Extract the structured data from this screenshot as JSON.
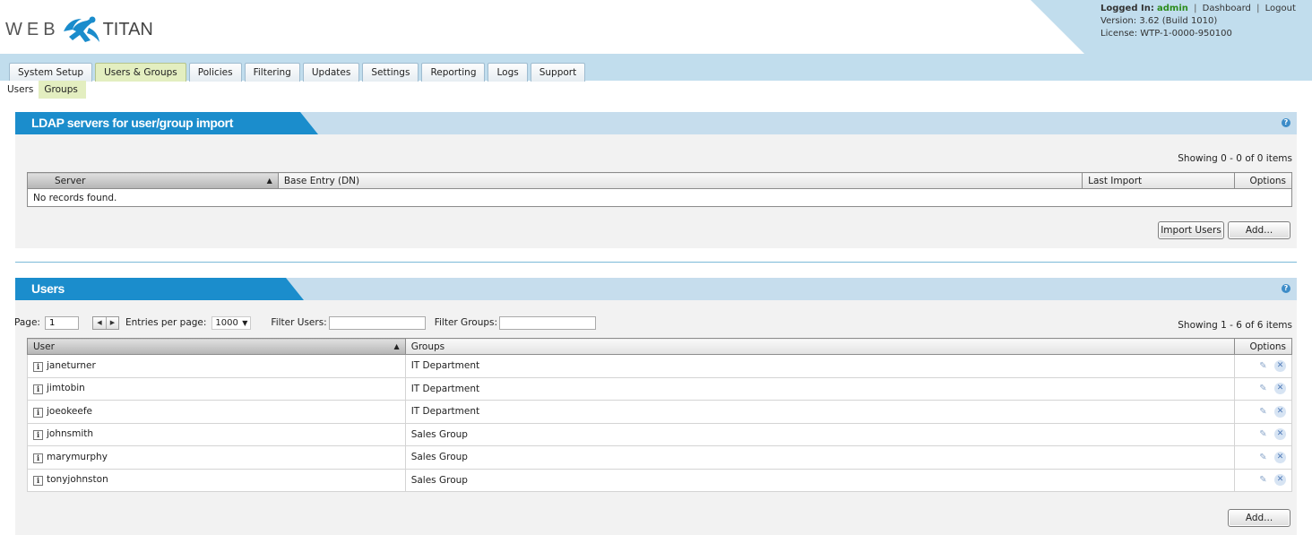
{
  "brand": {
    "logo_left": "WEB",
    "logo_right": "TITAN"
  },
  "header": {
    "logged_in_label": "Logged In:",
    "user": "admin",
    "dashboard_link": "Dashboard",
    "logout_link": "Logout",
    "version": "Version: 3.62 (Build 1010)",
    "license": "License: WTP-1-0000-950100"
  },
  "tabs": [
    {
      "label": "System Setup"
    },
    {
      "label": "Users & Groups",
      "active": true
    },
    {
      "label": "Policies"
    },
    {
      "label": "Filtering"
    },
    {
      "label": "Updates"
    },
    {
      "label": "Settings"
    },
    {
      "label": "Reporting"
    },
    {
      "label": "Logs"
    },
    {
      "label": "Support"
    }
  ],
  "subnav": {
    "users": "Users",
    "groups": "Groups",
    "selected": "Groups"
  },
  "ldap_panel": {
    "title": "LDAP servers for user/group import",
    "help": "?",
    "showing": "Showing 0 - 0 of 0 items",
    "columns": {
      "server": "Server",
      "base_entry": "Base Entry (DN)",
      "last_import": "Last Import",
      "options": "Options"
    },
    "empty_text": "No records found.",
    "import_button": "Import Users",
    "add_button": "Add..."
  },
  "users_panel": {
    "title": "Users",
    "help": "?",
    "page_label": "Page:",
    "page_value": "1",
    "entries_label": "Entries per page:",
    "entries_value": "1000",
    "filter_users_label": "Filter Users:",
    "filter_users_value": "",
    "filter_groups_label": "Filter Groups:",
    "filter_groups_value": "",
    "showing": "Showing 1 - 6 of 6 items",
    "columns": {
      "user": "User",
      "groups": "Groups",
      "options": "Options"
    },
    "rows": [
      {
        "user": "janeturner",
        "group": "IT Department"
      },
      {
        "user": "jimtobin",
        "group": "IT Department"
      },
      {
        "user": "joeokeefe",
        "group": "IT Department"
      },
      {
        "user": "johnsmith",
        "group": "Sales Group"
      },
      {
        "user": "marymurphy",
        "group": "Sales Group"
      },
      {
        "user": "tonyjohnston",
        "group": "Sales Group"
      }
    ],
    "add_button": "Add..."
  },
  "colors": {
    "accent_blue": "#1a8ccc",
    "band_blue": "#c1dded",
    "active_tab": "#e3eec0",
    "admin_green": "#2d8c1c"
  }
}
